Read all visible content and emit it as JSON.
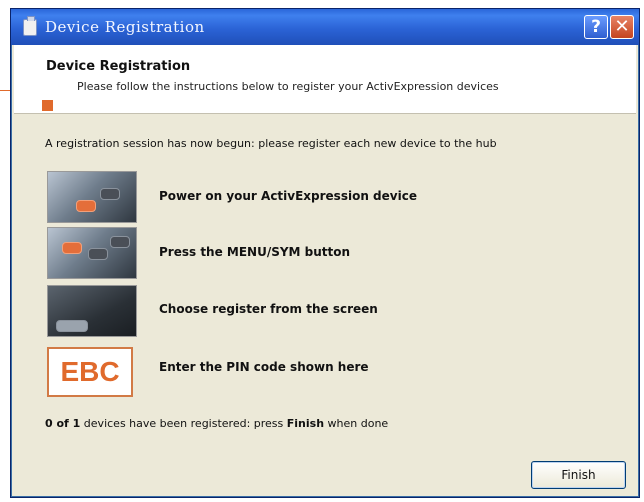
{
  "window": {
    "title": "Device Registration",
    "help_label": "?",
    "close_label": "✕"
  },
  "header": {
    "title": "Device Registration",
    "subtitle": "Please follow the instructions below to register your ActivExpression devices"
  },
  "intro": "A registration session has now begun: please register each new device to the hub",
  "steps": [
    {
      "label": "Power on your ActivExpression device"
    },
    {
      "label": "Press the MENU/SYM button"
    },
    {
      "label": "Choose register from the screen"
    },
    {
      "label": "Enter the PIN code shown here"
    }
  ],
  "pin_code": "EBC",
  "status": {
    "count": "0 of 1",
    "text_before": " devices have been registered: press ",
    "finish_word": "Finish",
    "text_after": " when done"
  },
  "buttons": {
    "finish": "Finish"
  },
  "colors": {
    "accent": "#e06a2c",
    "titlebar": "#2b63d6",
    "dialog_bg": "#ece9d8"
  }
}
